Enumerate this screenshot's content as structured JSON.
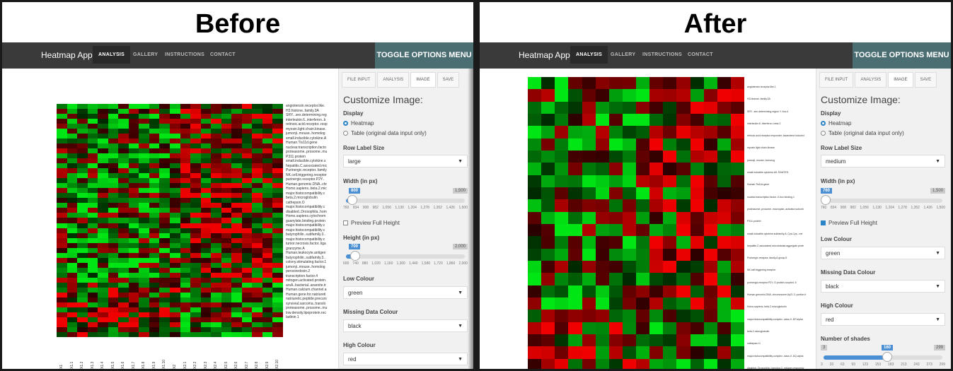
{
  "before": {
    "caption": "Before",
    "app": {
      "brand": "Heatmap App",
      "nav": [
        "ANALYSIS",
        "GALLERY",
        "INSTRUCTIONS",
        "CONTACT"
      ],
      "toggle": "TOGGLE OPTIONS MENU"
    },
    "tabs": [
      "FILE INPUT",
      "ANALYSIS",
      "IMAGE",
      "SAVE"
    ],
    "panel_title": "Customize Image:",
    "display": {
      "label": "Display",
      "options": [
        "Heatmap",
        "Table (original data input only)"
      ]
    },
    "row_label_size": {
      "label": "Row Label Size",
      "value": "large"
    },
    "width": {
      "label": "Width (in px)",
      "value": "800",
      "max": "1,500",
      "ticks": [
        "760",
        "834",
        "908",
        "982",
        "1,056",
        "1,130",
        "1,204",
        "1,278",
        "1,352",
        "1,426",
        "1,500"
      ]
    },
    "preview_full_height": "Preview Full Height",
    "height": {
      "label": "Height (in px)",
      "value": "700",
      "max": "2,000",
      "ticks": [
        "600",
        "740",
        "880",
        "1,020",
        "1,160",
        "1,300",
        "1,440",
        "1,580",
        "1,720",
        "1,860",
        "2,000"
      ]
    },
    "low_colour": {
      "label": "Low Colour",
      "value": "green"
    },
    "missing_colour": {
      "label": "Missing Data Colour",
      "value": "black"
    },
    "high_colour": {
      "label": "High Colour",
      "value": "red"
    },
    "row_labels": [
      "angiotensin.receptor.like.",
      "H3.histone..family.3A",
      "SRY...sex.determining.reg",
      "interleukin.6..interferon..b",
      "retinoic.acid.receptor..resp",
      "myosin.light.chain.kinase.",
      "jumonji..mouse..homolog",
      "small.inducible.cytokine.A",
      "Human.Tis11d.gene",
      "nuclear.transcription.facto",
      "proteasome..prosome..mu",
      "P311.protein",
      "small.inducible.cytokine.s",
      "hepatitis.C.associated.mic",
      "Purinergic.receptor..family",
      "NK.cell.triggering.receptor",
      "purinergic.receptor.P2Y..",
      "Human.genomic.DNA..chr",
      "Homo.sapiens..beta.2.mic",
      "major.histocompatibility.c",
      "beta.2.microglobulin",
      "cathepsin.O",
      "major.histocompatibility.c",
      "disabled..Drosophila..hom",
      "Homo.sapiens.cytochrom",
      "guanylate.binding.protein",
      "major.histocompatibility.c",
      "major.histocompatibility.c",
      "butyrophilin..subfamily.3..",
      "major.histocompatibility.c",
      "tumor.necrosis.factor..liga",
      "granzyme.A",
      "Human.leukocyte.antigen",
      "butyrophilin..subfamily.3..",
      "colony.stimulating.factor.1",
      "jumonji..mouse..homolog",
      "peroxiredoxin.2",
      "transcription.factor.4",
      "mitogen.activated.protein.",
      "arsA..bacterial..arsenite.tr",
      "Human.calcium.channel.a",
      "Human.gene.for.natriureti",
      "natriuretic.peptide.precurs",
      "synovial.sarcoma..translo",
      "proteasome..prosome..mu",
      "low.density.lipoprotein.rec",
      "ladinin.1"
    ],
    "col_labels": [
      "X1",
      "X1.1",
      "X1.2",
      "X1.3",
      "X1.4",
      "X1.5",
      "X1.6",
      "X1.7",
      "X1.8",
      "X1.9",
      "X1.10",
      "X2",
      "X2.1",
      "X2.2",
      "X2.3",
      "X2.4",
      "X2.5",
      "X2.6",
      "X2.7",
      "X2.8",
      "X2.9",
      "X2.10"
    ]
  },
  "after": {
    "caption": "After",
    "app": {
      "brand": "Heatmap App",
      "nav": [
        "ANALYSIS",
        "GALLERY",
        "INSTRUCTIONS",
        "CONTACT"
      ],
      "toggle": "TOGGLE OPTIONS MENU"
    },
    "tabs": [
      "FILE INPUT",
      "ANALYSIS",
      "IMAGE",
      "SAVE"
    ],
    "panel_title": "Customize Image:",
    "display": {
      "label": "Display",
      "options": [
        "Heatmap",
        "Table (original data input only)"
      ]
    },
    "row_label_size": {
      "label": "Row Label Size",
      "value": "medium"
    },
    "width": {
      "label": "Width (in px)",
      "value": "760",
      "max": "1,500",
      "ticks": [
        "760",
        "834",
        "908",
        "982",
        "1,056",
        "1,130",
        "1,204",
        "1,278",
        "1,352",
        "1,426",
        "1,500"
      ]
    },
    "preview_full_height": "Preview Full Height",
    "low_colour": {
      "label": "Low Colour",
      "value": "green"
    },
    "missing_colour": {
      "label": "Missing Data Colour",
      "value": "black"
    },
    "high_colour": {
      "label": "High Colour",
      "value": "red"
    },
    "shades": {
      "label": "Number of shades",
      "min": "3",
      "value": "160",
      "max": "299",
      "ticks": [
        "3",
        "33",
        "63",
        "93",
        "123",
        "153",
        "183",
        "213",
        "243",
        "273",
        "299"
      ]
    },
    "row_labels": [
      "angiotensin.receptor.like.1",
      "H3.histone..family.3A",
      "SRY...sex.determining.region.Y..box.4",
      "interleukin.6..interferon..beta.2.",
      "retinoic.acid.receptor.responder..tazarotene.induced",
      "myosin.light.chain.kinase",
      "jumonji..mouse..homolog",
      "small.inducible.cytokine.A5..RANTES.",
      "Human.Tis11d.gene",
      "nuclear.transcription.factor..X.box.binding.1",
      "proteasome..prosome..macropain..activator.subunit",
      "P311.protein",
      "small.inducible.cytokine.subfamily.A..Cys.Cys...me",
      "hepatitis.C.associated.microtubular.aggregate.prote",
      "Purinergic.receptor..family.A.group.5",
      "NK.cell.triggering.receptor",
      "purinergic.receptor.P2Y..G.protein.coupled..5",
      "Human.genomic.DNA..chromosome.6p21.3..portion.fr",
      "Homo.sapiens..beta.2.microglobulin",
      "major.histocompatibility.complex..class.II..DP.alpha",
      "beta.2.microglobulin",
      "cathepsin.O",
      "major.histocompatibility.complex..class.II..DQ.alpha",
      "disabled..Drosophila..homolog.2..mitogen.responsiv"
    ]
  }
}
